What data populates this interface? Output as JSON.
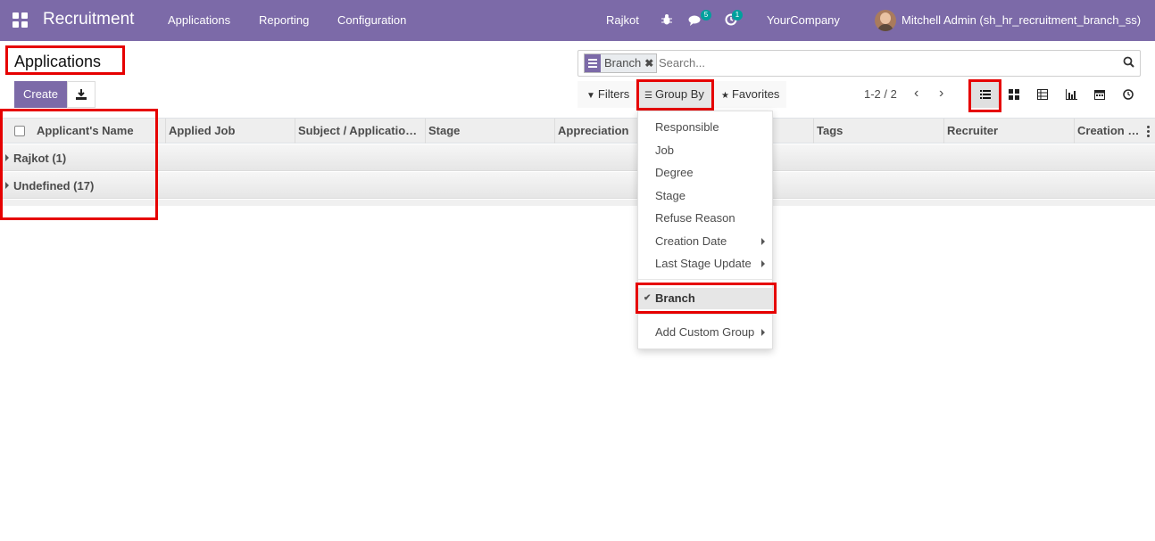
{
  "navbar": {
    "app_name": "Recruitment",
    "menus": [
      "Applications",
      "Reporting",
      "Configuration"
    ],
    "branch": "Rajkot",
    "messages_count": "5",
    "activities_count": "1",
    "company": "YourCompany",
    "user": "Mitchell Admin (sh_hr_recruitment_branch_ss)",
    "bar_color": "#7c6aa8"
  },
  "control_panel": {
    "title": "Applications",
    "create_label": "Create",
    "search": {
      "facet_label": "Branch",
      "placeholder": "Search..."
    },
    "filters_label": "Filters",
    "group_by_label": "Group By",
    "favorites_label": "Favorites",
    "pager": "1-2 / 2",
    "views": [
      "list-icon",
      "kanban-icon",
      "pivot-icon",
      "graph-icon",
      "calendar-icon",
      "activity-icon"
    ],
    "active_view": "list"
  },
  "list": {
    "columns": [
      "Applicant's Name",
      "Applied Job",
      "Subject / Applicatio…",
      "Stage",
      "Appreciation",
      "",
      "Tags",
      "Recruiter",
      "Creation …"
    ],
    "groups": [
      {
        "label": "Rajkot (1)"
      },
      {
        "label": "Undefined (17)"
      }
    ]
  },
  "group_by_menu": {
    "items": [
      "Responsible",
      "Job",
      "Degree",
      "Stage",
      "Refuse Reason",
      "Creation Date",
      "Last Stage Update"
    ],
    "selected": "Branch",
    "custom": "Add Custom Group"
  },
  "highlight_color": "#e60000"
}
